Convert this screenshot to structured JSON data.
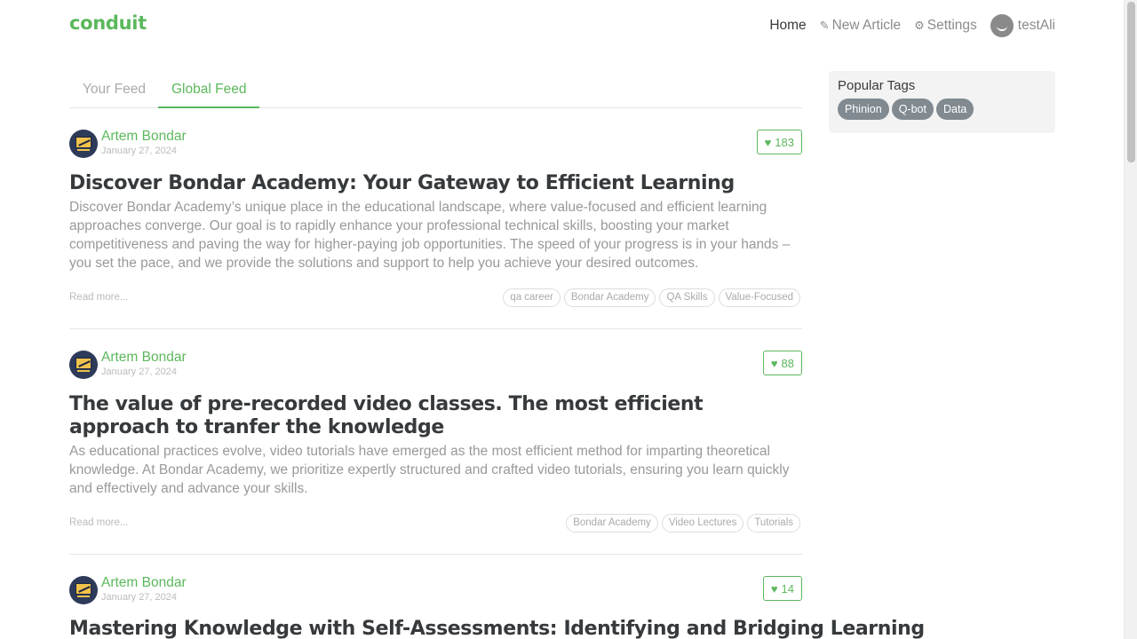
{
  "navbar": {
    "brand": "conduit",
    "items": [
      {
        "label": "Home",
        "icon": ""
      },
      {
        "label": "New Article",
        "icon": "edit-icon"
      },
      {
        "label": "Settings",
        "icon": "gear-icon"
      },
      {
        "label": "testAli",
        "icon": "avatar"
      }
    ]
  },
  "feed": {
    "tabs": [
      "Your Feed",
      "Global Feed"
    ],
    "active_tab": "Global Feed"
  },
  "articles": [
    {
      "author": "Artem Bondar",
      "date": "January 27, 2024",
      "likes": "183",
      "title": "Discover Bondar Academy: Your Gateway to Efficient Learning",
      "description": "Discover Bondar Academy’s unique place in the educational landscape, where value-focused and efficient learning approaches converge. Our goal is to rapidly enhance your professional technical skills, boosting your market competitiveness and paving the way for higher-paying job opportunities. The speed of your progress is in your hands – you set the pace, and we provide the solutions and support to help you achieve your desired outcomes.",
      "read_more": "Read more...",
      "tags": [
        "qa career",
        "Bondar Academy",
        "QA Skills",
        "Value-Focused"
      ]
    },
    {
      "author": "Artem Bondar",
      "date": "January 27, 2024",
      "likes": "88",
      "title": "The value of pre-recorded video classes. The most efficient approach to tranfer the knowledge",
      "description": "As educational practices evolve, video tutorials have emerged as the most efficient method for imparting theoretical knowledge. At Bondar Academy, we prioritize expertly structured and crafted video tutorials, ensuring you learn quickly and effectively and advance your skills.",
      "read_more": "Read more...",
      "tags": [
        "Bondar Academy",
        "Video Lectures",
        "Tutorials"
      ]
    },
    {
      "author": "Artem Bondar",
      "date": "January 27, 2024",
      "likes": "14",
      "title": "Mastering Knowledge with Self-Assessments: Identifying and Bridging Learning",
      "description": "",
      "read_more": "",
      "tags": []
    }
  ],
  "sidebar": {
    "title": "Popular Tags",
    "tags": [
      "Phinion",
      "Q-bot",
      "Data"
    ]
  },
  "colors": {
    "accent": "#5cb85c",
    "tag_pill": "#818a91"
  }
}
